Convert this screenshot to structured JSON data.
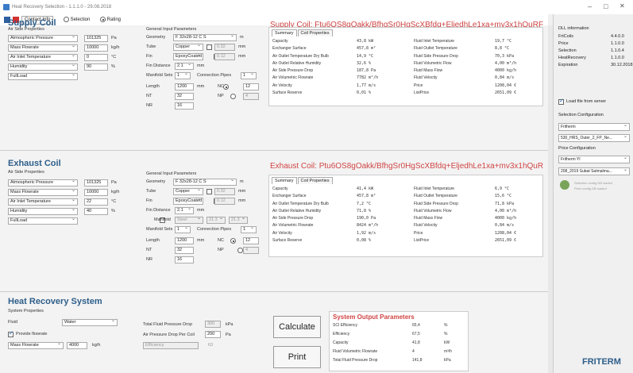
{
  "window": {
    "title": "Heat Recovery Selection - 1.1.1.0 - 29.08.2018",
    "minimize": "–",
    "maximize": "□",
    "close": "✕"
  },
  "toolbar": {
    "contact": "Contact Info",
    "selection": "Selection",
    "rating": "Rating"
  },
  "supply": {
    "title": "Supply Coil",
    "coil_title": "Supply Coil: Ftu6OS8gOakk/BfhgSr0HgScXBfdq+EljedhLe1xa+mv3x1hQuRF",
    "air": {
      "header": "Air Side Properties",
      "fields": [
        {
          "label": "Atmospheric Pressure",
          "value": "101325",
          "unit": "Pa"
        },
        {
          "label": "Mass Flowrate",
          "value": "10000",
          "unit": "kg/h"
        },
        {
          "label": "Air Inlet Temperature",
          "value": "0",
          "unit": "°C"
        },
        {
          "label": "Humidity",
          "value": "90",
          "unit": "%"
        },
        {
          "label": "FullLoad",
          "value": "",
          "unit": ""
        }
      ]
    },
    "gen": {
      "header": "General Input Parameters",
      "geometry": "F 32x28-12 C S",
      "geometry_unit": "m",
      "tube": "Copper",
      "tube_val": "0.32",
      "fin": "EpoxyCoated",
      "fin_val": "0.12",
      "fin_distance": "2.1",
      "manifold_sets": "1",
      "conn_label": "Connection Pipes",
      "conn_val": "1",
      "length": "1200",
      "nt": "32",
      "nr": "16",
      "nc_val": "12",
      "np_val": "4"
    },
    "results": {
      "left": [
        [
          "Capacity",
          "43,8 kW"
        ],
        [
          "Exchanger Surface",
          "457,8 m²"
        ],
        [
          "Air Outlet Temperature Dry Bulb",
          "14,9 °C"
        ],
        [
          "Air Outlet Relative Humidity",
          "32,6 %"
        ],
        [
          "Air Side Pressure Drop",
          "187,8 Pa"
        ],
        [
          "Air Volumetric Flowrate",
          "7782 m³/h"
        ],
        [
          "Air Velocity",
          "1,77 m/s"
        ],
        [
          "Surface Reserve",
          "0,01 %"
        ]
      ],
      "right": [
        [
          "Fluid Inlet Temperature",
          "19,7 °C"
        ],
        [
          "Fluid Outlet Temperature",
          "8,8 °C"
        ],
        [
          "Fluid Side Pressure Drop",
          "70,3 kPa"
        ],
        [
          "Fluid Volumetric Flow",
          "4,00 m³/h"
        ],
        [
          "Fluid Mass Flow",
          "4000 kg/h"
        ],
        [
          "Fluid Velocity",
          "0,84 m/s"
        ],
        [
          "Price",
          "1208,04 €"
        ],
        [
          "ListPrice",
          "2651,09 €"
        ]
      ]
    }
  },
  "exhaust": {
    "title": "Exhaust Coil",
    "coil_title": "Exhaust Coil: Ptu6OS8gOakk/BfhgSr0HgScXBfdq+EljedhLe1xa+mv3x1hQuR",
    "air": {
      "header": "Air Side Properties",
      "fields": [
        {
          "label": "Atmospheric Pressure",
          "value": "101325",
          "unit": "Pa"
        },
        {
          "label": "Mass Flowrate",
          "value": "10000",
          "unit": "kg/h"
        },
        {
          "label": "Air Inlet Temperature",
          "value": "22",
          "unit": "°C"
        },
        {
          "label": "Humidity",
          "value": "40",
          "unit": "%"
        },
        {
          "label": "FullLoad",
          "value": "",
          "unit": ""
        }
      ]
    },
    "gen": {
      "header": "General Input Parameters",
      "geometry": "F 32x28-12 C S",
      "geometry_unit": "m",
      "tube": "Copper",
      "tube_val": "0.32",
      "fin": "EpoxyCoated",
      "fin_val": "0.12",
      "fin_distance": "2.1",
      "manifold": "Steel",
      "manifold_v1": "21.3",
      "manifold_v2": "21.3",
      "manifold_sets": "1",
      "conn_label": "Connection Pipes",
      "conn_val": "1",
      "length": "1200",
      "nt": "32",
      "nr": "16",
      "nc_val": "12",
      "np_val": "4"
    },
    "results": {
      "left": [
        [
          "Capacity",
          "41,4 kW"
        ],
        [
          "Exchanger Surface",
          "457,8 m²"
        ],
        [
          "Air Outlet Temperature Dry Bulb",
          "7,2 °C"
        ],
        [
          "Air Outlet Relative Humidity",
          "71,8 %"
        ],
        [
          "Air Side Pressure Drop",
          "190,0 Pa"
        ],
        [
          "Air Volumetric Flowrate",
          "8424 m³/h"
        ],
        [
          "Air Velocity",
          "1,92 m/s"
        ],
        [
          "Surface Reserve",
          "0,08 %"
        ]
      ],
      "right": [
        [
          "Fluid Inlet Temperature",
          "6,9 °C"
        ],
        [
          "Fluid Outlet Temperature",
          "15,6 °C"
        ],
        [
          "Fluid Side Pressure Drop",
          "71,8 kPa"
        ],
        [
          "Fluid Volumetric Flow",
          "4,00 m³/h"
        ],
        [
          "Fluid Mass Flow",
          "4000 kg/h"
        ],
        [
          "Fluid Velocity",
          "0,84 m/s"
        ],
        [
          "Price",
          "1208,04 €"
        ],
        [
          "ListPrice",
          "2651,09 €"
        ]
      ]
    }
  },
  "labels": {
    "summary": "Summary",
    "coil_props": "Coil Properties",
    "geometry": "Geometry",
    "tube": "Tube",
    "fin": "Fin",
    "fin_distance": "Fin Distance",
    "manifold": "Manifold",
    "manifold_sets": "Manifold Sets",
    "length": "Length",
    "nt": "NT",
    "nr": "NR",
    "nc": "NC",
    "np": "NP",
    "mm": "mm",
    "m": "m"
  },
  "hrs": {
    "title": "Heat Recovery System",
    "header": "System Properties",
    "fluid_label": "Fluid",
    "fluid": "Water",
    "provide_flowrate": "Provide flowrate",
    "mass_flowrate": "Mass Flowrate",
    "mass_value": "4000",
    "mass_unit": "kg/h",
    "total_dp_label": "Total Fluid Pressure Drop",
    "total_dp": "300",
    "total_dp_unit": "kPa",
    "air_dp_label": "Air Pressure Drop Per Coil",
    "air_dp": "200",
    "air_dp_unit": "Pa",
    "eff_label": "Efficiency",
    "eff_val": "63",
    "calculate": "Calculate",
    "print": "Print",
    "output_title": "System Output Parameters",
    "outputs": [
      [
        "SCI Efficiency",
        "65,4",
        "%"
      ],
      [
        "Efficiency",
        "67,5",
        "%"
      ],
      [
        "Capacity",
        "41,8",
        "kW"
      ],
      [
        "Fluid Volumetric Flowrate",
        "4",
        "m³/h"
      ],
      [
        "Total Fluid Pressure Drop",
        "141,8",
        "kPa"
      ]
    ]
  },
  "side": {
    "dll_title": "DLL information",
    "dll": [
      [
        "FrtCoils",
        "4.4.0.0"
      ],
      [
        "Price",
        "1.1.0.0"
      ],
      [
        "Selection",
        "1.1.0.4"
      ],
      [
        "HeatRecovery",
        "1.1.0.0"
      ],
      [
        "Expiration",
        "30.12.2018"
      ]
    ],
    "load_server": "Load file from server",
    "sel_conf": "Selection Configuration",
    "sel_conf_val": "Fritherm",
    "sel_file": "530_HRS_Outer_2_FP_Ne...",
    "price_conf": "Price Configuration",
    "price_conf_val": "Fritherm YI",
    "price_file": "208_2019 Subat Satmalma...",
    "status1": "Selection config DB loaded",
    "status2": "Price config DB loaded",
    "logo": "FRITERM"
  }
}
